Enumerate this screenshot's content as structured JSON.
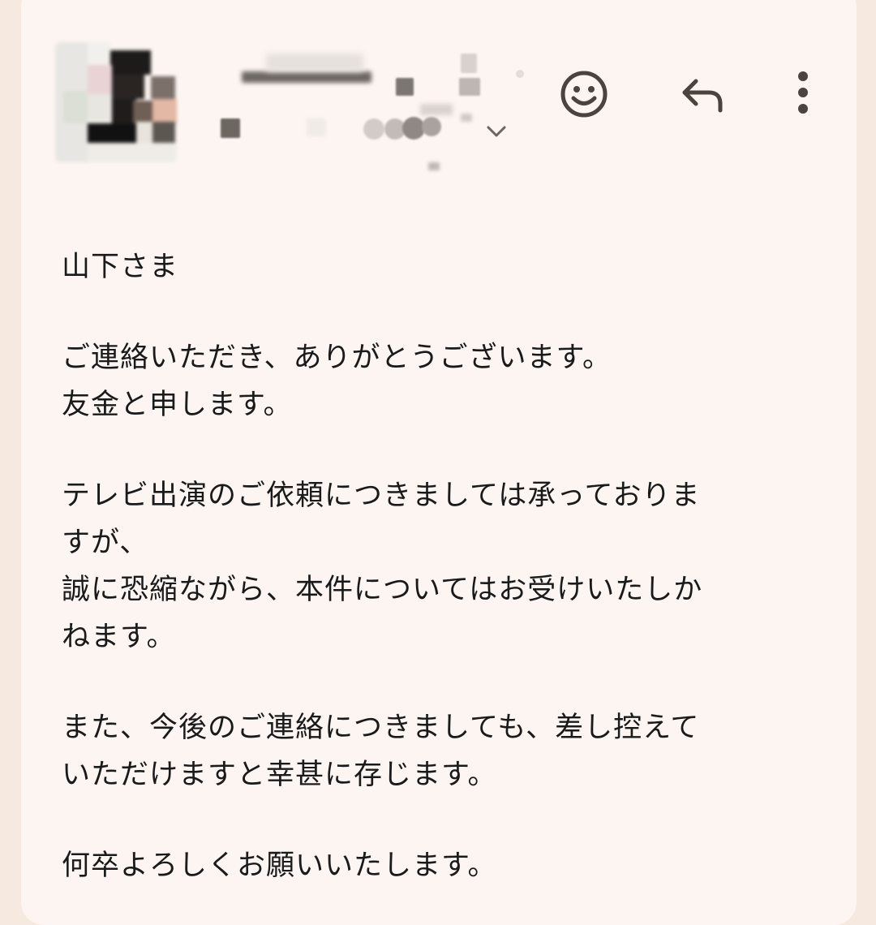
{
  "header": {
    "icons": {
      "avatar": "sender-avatar-blurred",
      "sender_name": "sender-name-blurred",
      "expand": "chevron-down-icon",
      "emoji": "smiley-face-icon",
      "reply": "reply-arrow-icon",
      "more": "more-vertical-icon"
    }
  },
  "email": {
    "greeting": "山下さま",
    "para1": [
      "ご連絡いただき、ありがとうございます。",
      "友金と申します。"
    ],
    "para2": [
      "テレビ出演のご依頼につきましては承っておりま",
      "すが、",
      "誠に恐縮ながら、本件についてはお受けいたしか",
      "ねます。"
    ],
    "para3": [
      "また、今後のご連絡につきましても、差し控えて",
      "いただけますと幸甚に存じます。"
    ],
    "closing": "何卒よろしくお願いいたします。"
  },
  "colors": {
    "page_background": "#f6e9df",
    "card_background": "#fdf5f2",
    "icon_color": "#4a443f",
    "text_color": "#1a1a1a"
  }
}
